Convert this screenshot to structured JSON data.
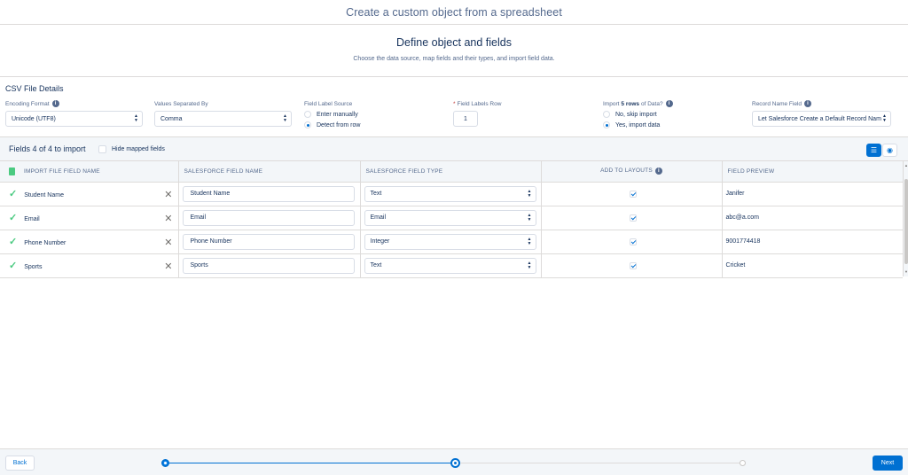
{
  "window_title": "Create a custom object from a spreadsheet",
  "heading": {
    "title": "Define object and fields",
    "subtitle": "Choose the data source, map fields and their types, and import field data."
  },
  "csv": {
    "section_title": "CSV File Details",
    "encoding": {
      "label": "Encoding Format",
      "value": "Unicode (UTF8)"
    },
    "separator": {
      "label": "Values Separated By",
      "value": "Comma"
    },
    "label_source": {
      "label": "Field Label Source",
      "options": [
        "Enter manually",
        "Detect from row"
      ],
      "selected": "Detect from row"
    },
    "labels_row": {
      "label": "Field Labels Row",
      "value": "1"
    },
    "import_rows": {
      "label_pre": "Import",
      "label_bold": "5 rows",
      "label_post": "of Data?",
      "options": [
        "No, skip import",
        "Yes, import data"
      ],
      "selected": "Yes, import data"
    },
    "record_name": {
      "label": "Record Name Field",
      "value": "Let Salesforce Create a Default Record Nam"
    }
  },
  "fields_bar": {
    "count_text": "Fields 4 of 4 to import",
    "hide_mapped": "Hide mapped fields"
  },
  "table": {
    "headers": [
      "IMPORT FILE FIELD NAME",
      "SALESFORCE FIELD NAME",
      "SALESFORCE FIELD TYPE",
      "ADD TO LAYOUTS",
      "FIELD PREVIEW"
    ],
    "rows": [
      {
        "import_name": "Student Name",
        "sf_name": "Student Name",
        "type": "Text",
        "add": true,
        "preview": "Janifer"
      },
      {
        "import_name": "Email",
        "sf_name": "Email",
        "type": "Email",
        "add": true,
        "preview": "abc@a.com"
      },
      {
        "import_name": "Phone Number",
        "sf_name": "Phone Number",
        "type": "Integer",
        "add": true,
        "preview": "9001774418"
      },
      {
        "import_name": "Sports",
        "sf_name": "Sports",
        "type": "Text",
        "add": true,
        "preview": "Cricket"
      }
    ]
  },
  "footer": {
    "back": "Back",
    "next": "Next",
    "current_step": 2,
    "total_steps": 3
  },
  "colors": {
    "brand": "#0070d2",
    "success": "#4bca81",
    "text": "#16325c"
  }
}
